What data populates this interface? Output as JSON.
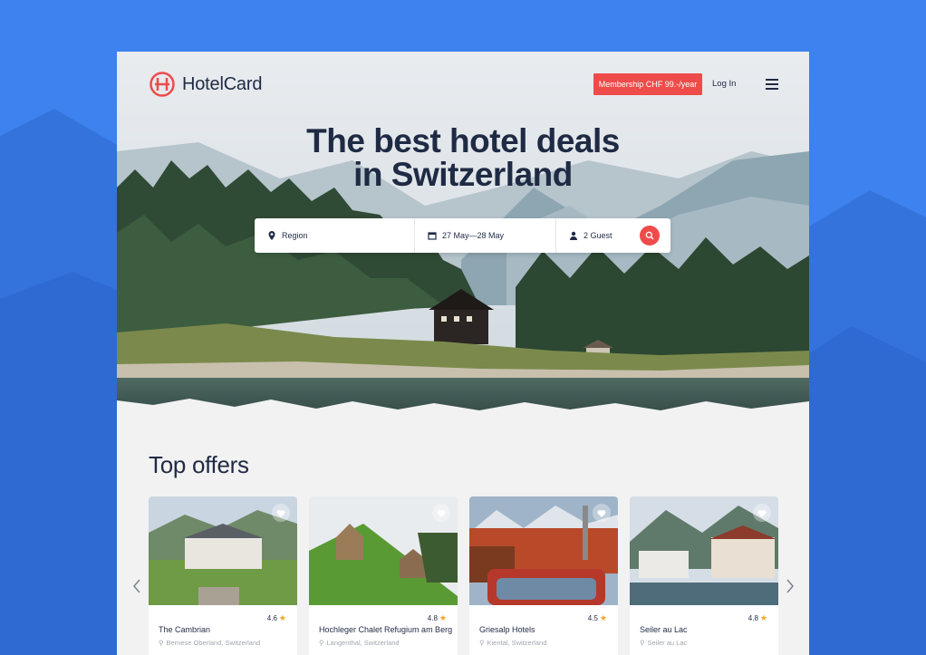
{
  "brand": {
    "name": "HotelCard",
    "color": "#ef4b4b",
    "text_color": "#1f2a44"
  },
  "header": {
    "membership_label": "Membership CHF 99.-/year",
    "login_label": "Log In",
    "menu_icon": "hamburger-icon"
  },
  "hero": {
    "headline_line1": "The best hotel deals",
    "headline_line2": "in Switzerland"
  },
  "search": {
    "region_placeholder": "Region",
    "dates_value": "27 May—28 May",
    "guests_value": "2 Guest"
  },
  "offers": {
    "title": "Top offers",
    "cards": [
      {
        "name": "The Cambrian",
        "location": "Bernese Oberland, Switzerland",
        "rating": "4.6"
      },
      {
        "name": "Hochleger Chalet Refugium am Berg",
        "location": "Langenthal, Switzerland",
        "rating": "4.8"
      },
      {
        "name": "Griesalp Hotels",
        "location": "Kiental, Switzerland",
        "rating": "4.5"
      },
      {
        "name": "Seiler au Lac",
        "location": "Seiler au Lac",
        "rating": "4.8"
      }
    ]
  },
  "colors": {
    "page_bg": "#3d82ee",
    "accent": "#ef4b4b",
    "star": "#f4a524"
  }
}
